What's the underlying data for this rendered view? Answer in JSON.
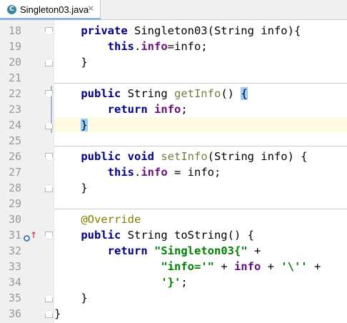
{
  "tab": {
    "title": "Singleton03.java",
    "icon_letter": "C",
    "close": "✕"
  },
  "lines": [
    {
      "num": "18",
      "text": [
        [
          "",
          "    "
        ],
        [
          "kw",
          "private"
        ],
        [
          "",
          " Singleton03(String info){"
        ]
      ]
    },
    {
      "num": "19",
      "text": [
        [
          "",
          "        "
        ],
        [
          "kw",
          "this"
        ],
        [
          "",
          "."
        ],
        [
          "fld",
          "info"
        ],
        [
          "",
          "=info;"
        ]
      ]
    },
    {
      "num": "20",
      "text": [
        [
          "",
          "    }"
        ]
      ]
    },
    {
      "num": "21",
      "text": []
    },
    {
      "num": "22",
      "text": [
        [
          "",
          "    "
        ],
        [
          "kw",
          "public"
        ],
        [
          "",
          " String "
        ],
        [
          "fn",
          "getInfo"
        ],
        [
          "",
          "() "
        ],
        [
          "br",
          "{"
        ]
      ]
    },
    {
      "num": "23",
      "text": [
        [
          "",
          "        "
        ],
        [
          "kw",
          "return"
        ],
        [
          "",
          " "
        ],
        [
          "fld",
          "info"
        ],
        [
          "",
          ";"
        ]
      ]
    },
    {
      "num": "24",
      "text": [
        [
          "",
          "    "
        ],
        [
          "br",
          "}"
        ]
      ]
    },
    {
      "num": "25",
      "text": []
    },
    {
      "num": "26",
      "text": [
        [
          "",
          "    "
        ],
        [
          "kw",
          "public void"
        ],
        [
          "",
          " "
        ],
        [
          "fn",
          "setInfo"
        ],
        [
          "",
          "(String info) {"
        ]
      ]
    },
    {
      "num": "27",
      "text": [
        [
          "",
          "        "
        ],
        [
          "kw",
          "this"
        ],
        [
          "",
          "."
        ],
        [
          "fld",
          "info"
        ],
        [
          "",
          " = info;"
        ]
      ]
    },
    {
      "num": "28",
      "text": [
        [
          "",
          "    }"
        ]
      ]
    },
    {
      "num": "29",
      "text": []
    },
    {
      "num": "30",
      "text": [
        [
          "",
          "    "
        ],
        [
          "ann",
          "@Override"
        ]
      ]
    },
    {
      "num": "31",
      "text": [
        [
          "",
          "    "
        ],
        [
          "kw",
          "public"
        ],
        [
          "",
          " String toString() {"
        ]
      ]
    },
    {
      "num": "32",
      "text": [
        [
          "",
          "        "
        ],
        [
          "kw",
          "return"
        ],
        [
          "",
          " "
        ],
        [
          "str",
          "\"Singleton03{\""
        ],
        [
          "",
          " +"
        ]
      ]
    },
    {
      "num": "33",
      "text": [
        [
          "",
          "                "
        ],
        [
          "str",
          "\"info='\""
        ],
        [
          "",
          " + "
        ],
        [
          "fld",
          "info"
        ],
        [
          "",
          " + "
        ],
        [
          "str",
          "'\\''"
        ],
        [
          "",
          " +"
        ]
      ]
    },
    {
      "num": "34",
      "text": [
        [
          "",
          "                "
        ],
        [
          "str",
          "'}'"
        ],
        [
          "",
          ";"
        ]
      ]
    },
    {
      "num": "35",
      "text": [
        [
          "",
          "    }"
        ]
      ]
    },
    {
      "num": "36",
      "text": [
        [
          "",
          "}"
        ]
      ]
    }
  ]
}
